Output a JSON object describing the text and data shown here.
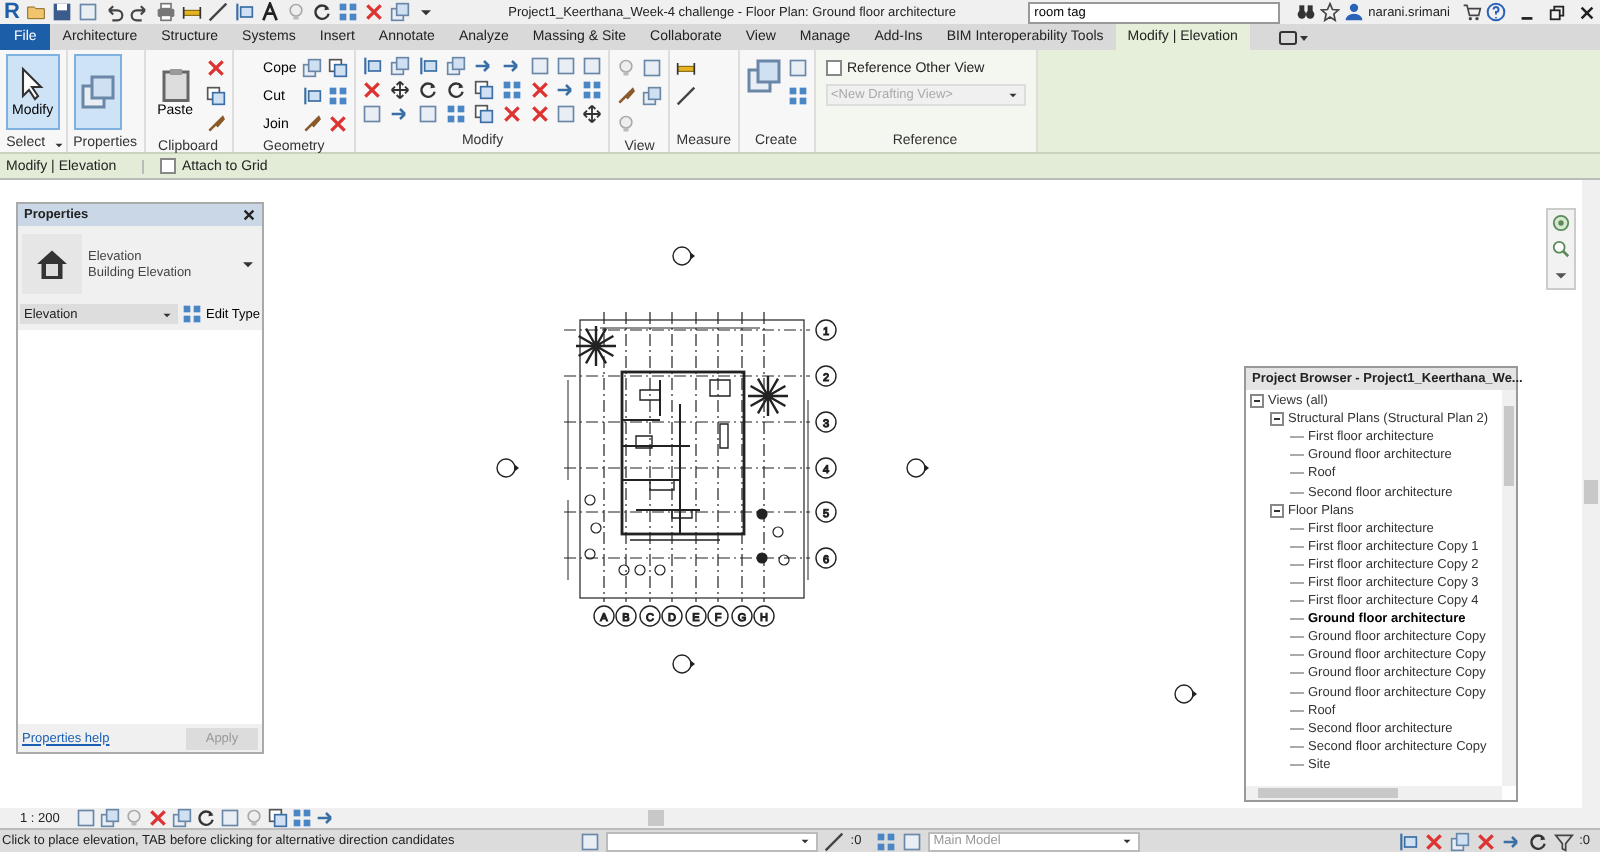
{
  "title_bar": {
    "app_logo": "R",
    "title": "Project1_Keerthana_Week-4 challenge - Floor Plan: Ground floor architecture",
    "search": {
      "value": "room tag"
    },
    "user": "narani.srimani"
  },
  "ribbon_tabs": [
    {
      "label": "File",
      "kind": "file",
      "selected": false
    },
    {
      "label": "Architecture",
      "kind": "tab",
      "selected": false
    },
    {
      "label": "Structure",
      "kind": "tab",
      "selected": false
    },
    {
      "label": "Systems",
      "kind": "tab",
      "selected": false
    },
    {
      "label": "Insert",
      "kind": "tab",
      "selected": false
    },
    {
      "label": "Annotate",
      "kind": "tab",
      "selected": false
    },
    {
      "label": "Analyze",
      "kind": "tab",
      "selected": false
    },
    {
      "label": "Massing & Site",
      "kind": "tab",
      "selected": false
    },
    {
      "label": "Collaborate",
      "kind": "tab",
      "selected": false
    },
    {
      "label": "View",
      "kind": "tab",
      "selected": false
    },
    {
      "label": "Manage",
      "kind": "tab",
      "selected": false
    },
    {
      "label": "Add-Ins",
      "kind": "tab",
      "selected": false
    },
    {
      "label": "BIM Interoperability Tools",
      "kind": "tab",
      "selected": false
    },
    {
      "label": "Modify | Elevation",
      "kind": "contextual",
      "selected": true
    }
  ],
  "ribbon_panels": [
    {
      "kind": "select",
      "label": "Select",
      "tools": [
        {
          "label": "Modify",
          "selected": true
        }
      ]
    },
    {
      "kind": "properties",
      "label": "Properties",
      "tools": [
        {
          "selected": true
        }
      ]
    },
    {
      "kind": "clipboard",
      "label": "Clipboard",
      "tools": [
        {
          "label": "Paste",
          "selected": false
        }
      ]
    },
    {
      "kind": "geometry",
      "label": "Geometry",
      "tools": [
        {
          "label": "Cope"
        },
        {
          "label": "Cut"
        },
        {
          "label": "Join"
        }
      ]
    },
    {
      "kind": "modify",
      "label": "Modify"
    },
    {
      "kind": "view",
      "label": "View"
    },
    {
      "kind": "measure",
      "label": "Measure"
    },
    {
      "kind": "create",
      "label": "Create"
    },
    {
      "kind": "reference",
      "label": "Reference",
      "checkbox": {
        "label": "Reference Other View",
        "checked": false
      },
      "dropdown": {
        "placeholder": "<New Drafting View>",
        "disabled": true
      }
    }
  ],
  "options_bar": {
    "label": "Modify | Elevation",
    "checkbox": {
      "label": "Attach to Grid",
      "checked": false
    }
  },
  "properties": {
    "title": "Properties",
    "type_name": "Elevation",
    "type_family": "Building Elevation",
    "selector": "Elevation",
    "edit_type": "Edit Type",
    "help_link": "Properties help",
    "apply": {
      "label": "Apply",
      "disabled": true
    }
  },
  "floor_plan": {
    "grid_rows": [
      "1",
      "2",
      "3",
      "4",
      "5",
      "6"
    ],
    "grid_columns": [
      "A",
      "B",
      "C",
      "D",
      "E",
      "F",
      "G",
      "H"
    ]
  },
  "project_browser": {
    "title": "Project Browser - Project1_Keerthana_We...",
    "tree": [
      {
        "label": "Views (all)",
        "expanded": true,
        "selected": false,
        "children": [
          {
            "label": "Structural Plans (Structural Plan 2)",
            "expanded": true,
            "selected": false,
            "children": [
              {
                "label": "First floor architecture",
                "selected": false
              },
              {
                "label": "Ground floor architecture",
                "selected": false
              },
              {
                "label": "Roof",
                "selected": false
              },
              {
                "label": "Second floor architecture",
                "selected": false
              }
            ]
          },
          {
            "label": "Floor Plans",
            "expanded": true,
            "selected": false,
            "children": [
              {
                "label": "First floor architecture",
                "selected": false
              },
              {
                "label": "First floor architecture Copy 1",
                "selected": false
              },
              {
                "label": "First floor architecture Copy 2",
                "selected": false
              },
              {
                "label": "First floor architecture Copy 3",
                "selected": false
              },
              {
                "label": "First floor architecture Copy 4",
                "selected": false
              },
              {
                "label": "Ground floor architecture",
                "selected": true
              },
              {
                "label": "Ground floor architecture Copy",
                "selected": false
              },
              {
                "label": "Ground floor architecture Copy",
                "selected": false
              },
              {
                "label": "Ground floor architecture Copy",
                "selected": false
              },
              {
                "label": "Ground floor architecture Copy",
                "selected": false
              },
              {
                "label": "Roof",
                "selected": false
              },
              {
                "label": "Second floor architecture",
                "selected": false
              },
              {
                "label": "Second floor architecture Copy",
                "selected": false
              },
              {
                "label": "Site",
                "selected": false
              }
            ]
          }
        ]
      }
    ]
  },
  "view_control_bar": {
    "scale": "1 : 200"
  },
  "status_bar": {
    "message": "Click to place elevation, TAB before clicking for alternative direction candidates",
    "count": ":0",
    "workset": "Main Model",
    "filter_count": ":0"
  }
}
